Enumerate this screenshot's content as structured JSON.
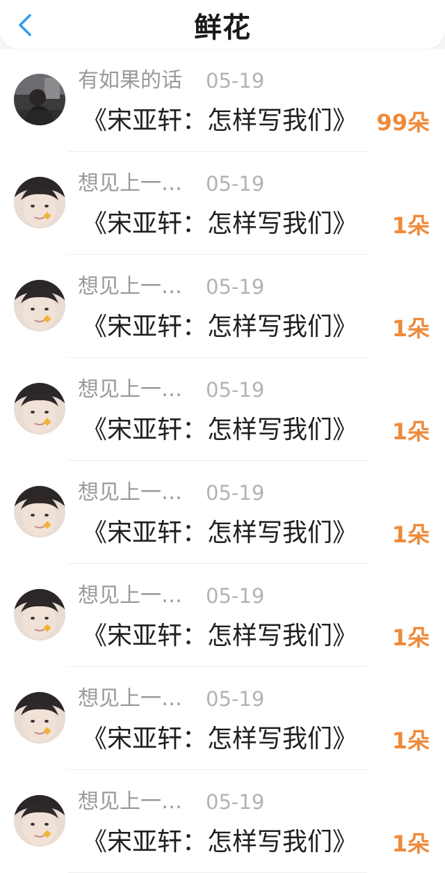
{
  "header": {
    "title": "鲜花"
  },
  "colors": {
    "accent_back": "#2f9bf2",
    "count_orange": "#ef8a3a",
    "name_gray": "#9a9a9a",
    "date_gray": "#b3b3b3"
  },
  "list": {
    "items": [
      {
        "name": "有如果的话",
        "date": "05-19",
        "work": "《宋亚轩：怎样写我们》",
        "count": "99朵",
        "avatar": "dark-photo"
      },
      {
        "name": "想见上一…",
        "date": "05-19",
        "work": "《宋亚轩：怎样写我们》",
        "count": "1朵",
        "avatar": "face"
      },
      {
        "name": "想见上一…",
        "date": "05-19",
        "work": "《宋亚轩：怎样写我们》",
        "count": "1朵",
        "avatar": "face"
      },
      {
        "name": "想见上一…",
        "date": "05-19",
        "work": "《宋亚轩：怎样写我们》",
        "count": "1朵",
        "avatar": "face"
      },
      {
        "name": "想见上一…",
        "date": "05-19",
        "work": "《宋亚轩：怎样写我们》",
        "count": "1朵",
        "avatar": "face"
      },
      {
        "name": "想见上一…",
        "date": "05-19",
        "work": "《宋亚轩：怎样写我们》",
        "count": "1朵",
        "avatar": "face"
      },
      {
        "name": "想见上一…",
        "date": "05-19",
        "work": "《宋亚轩：怎样写我们》",
        "count": "1朵",
        "avatar": "face"
      },
      {
        "name": "想见上一…",
        "date": "05-19",
        "work": "《宋亚轩：怎样写我们》",
        "count": "1朵",
        "avatar": "face"
      }
    ]
  }
}
